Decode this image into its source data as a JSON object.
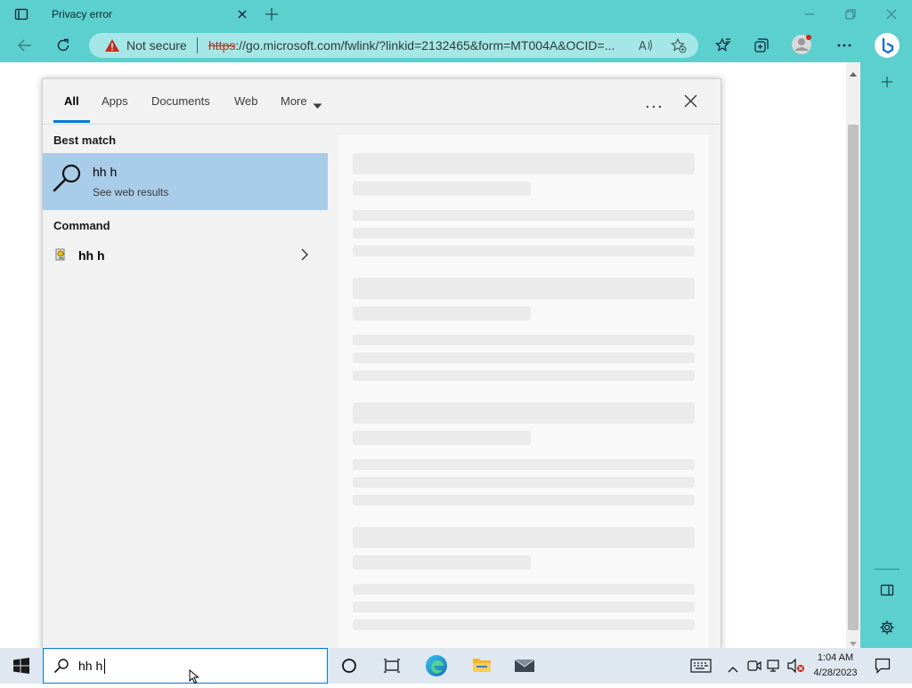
{
  "browser": {
    "tab_title": "Privacy error",
    "security_label": "Not secure",
    "url_scheme": "https",
    "url_rest": "://go.microsoft.com/fwlink/?linkid=2132465&form=MT004A&OCID=..."
  },
  "search": {
    "tabs": [
      "All",
      "Apps",
      "Documents",
      "Web",
      "More"
    ],
    "active_tab": "All",
    "best_match_heading": "Best match",
    "best_match_title": "hh h",
    "best_match_subtitle": "See web results",
    "command_heading": "Command",
    "command_item": "hh h"
  },
  "taskbar": {
    "search_text": "hh h",
    "time": "1:04 AM",
    "date": "4/28/2023"
  },
  "colors": {
    "chrome": "#5ccfcf",
    "accent": "#0078d4",
    "selection": "#a9cce8",
    "taskbar": "#dfe8f0"
  }
}
